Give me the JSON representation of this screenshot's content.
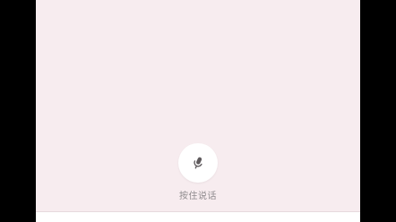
{
  "voice": {
    "hold_to_talk_label": "按住说话",
    "mic_icon": "microphone-icon"
  },
  "colors": {
    "background": "#f7ecef",
    "mic_button_bg": "#ffffff",
    "mic_icon": "#5f5a5d",
    "label_text": "#8e8a8d"
  }
}
